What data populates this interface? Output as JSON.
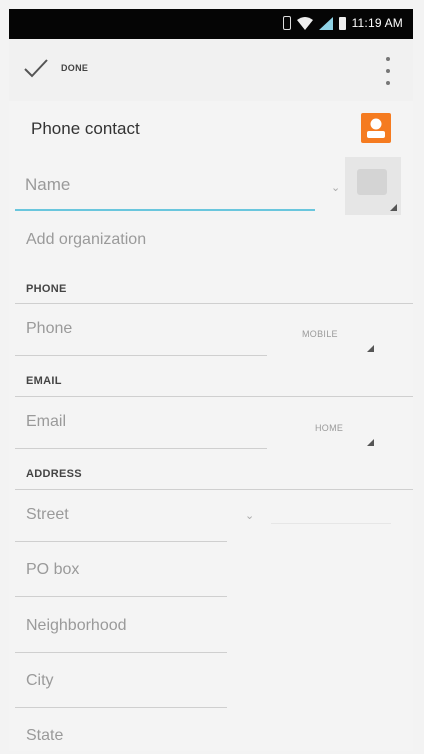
{
  "status_bar": {
    "time": "11:19 AM",
    "icons": [
      "vibrate-icon",
      "wifi-icon",
      "signal-icon",
      "battery-icon"
    ]
  },
  "action_bar": {
    "done_label": "DONE",
    "icons": [
      "check-icon",
      "overflow-menu-icon"
    ]
  },
  "account": {
    "label": "Phone contact",
    "icon": "contact-person-icon",
    "icon_color": "#f57b20"
  },
  "name": {
    "placeholder": "Name",
    "accent_color": "#69c6dd"
  },
  "organization": {
    "label": "Add organization"
  },
  "phone": {
    "header": "PHONE",
    "placeholder": "Phone",
    "type": "MOBILE"
  },
  "email": {
    "header": "EMAIL",
    "placeholder": "Email",
    "type": "HOME"
  },
  "address": {
    "header": "ADDRESS",
    "fields": [
      "Street",
      "PO box",
      "Neighborhood",
      "City",
      "State"
    ]
  }
}
